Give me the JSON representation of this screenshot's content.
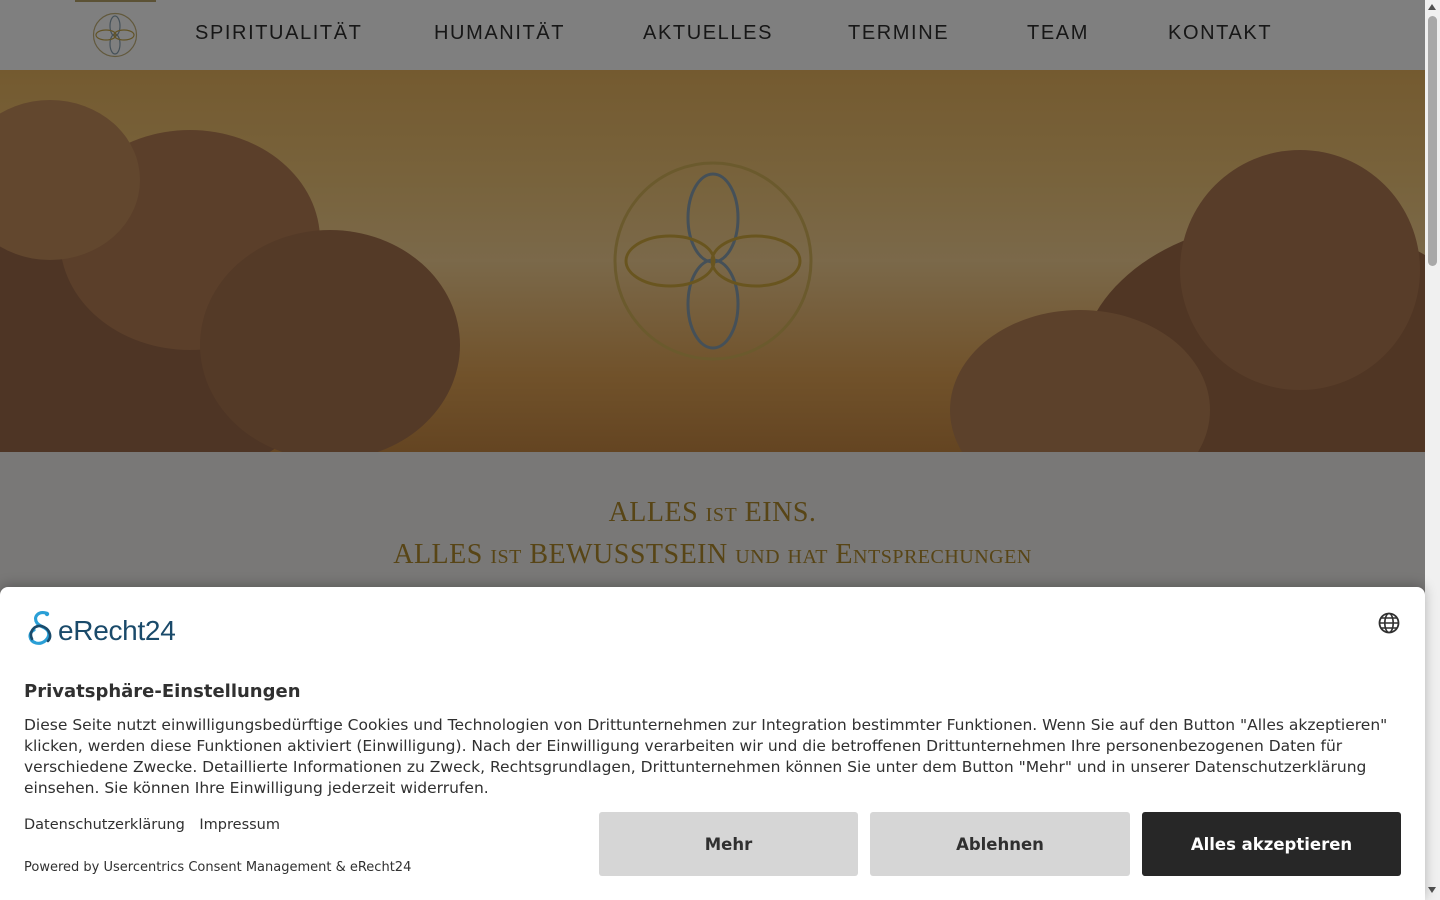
{
  "nav": {
    "items": [
      {
        "label": "SPIRITUALITÄT"
      },
      {
        "label": "HUMANITÄT"
      },
      {
        "label": "AKTUELLES"
      },
      {
        "label": "TERMINE"
      },
      {
        "label": "TEAM"
      },
      {
        "label": "KONTAKT"
      }
    ]
  },
  "hero": {
    "quote_lines": [
      "ALLES ist EINS.",
      "ALLES ist BEWUSSTSEIN und hat Entsprechungen"
    ]
  },
  "consent": {
    "brand": "eRecht24",
    "title": "Privatsphäre-Einstellungen",
    "description": "Diese Seite nutzt einwilligungsbedürftige Cookies und Technologien von Drittunternehmen zur Integration bestimmter Funktionen. Wenn Sie auf den Button \"Alles akzeptieren\" klicken, werden diese Funktionen aktiviert (Einwilligung). Nach der Einwilligung verarbeiten wir und die betroffenen Drittunternehmen Ihre personenbezogenen Daten für verschiedene Zwecke. Detaillierte Informationen zu Zweck, Rechtsgrundlagen, Drittunternehmen können Sie unter dem Button \"Mehr\" und in unserer Datenschutzerklärung einsehen. Sie können Ihre Einwilligung jederzeit widerrufen.",
    "links": {
      "privacy": "Datenschutzerklärung",
      "imprint": "Impressum"
    },
    "powered_by": "Powered by Usercentrics Consent Management & eRecht24",
    "buttons": {
      "more": "Mehr",
      "decline": "Ablehnen",
      "accept_all": "Alles akzeptieren"
    },
    "colors": {
      "accept_bg": "#272727",
      "secondary_bg": "#d6d6d6",
      "brand_blue": "#1a4a6a"
    }
  },
  "icons": {
    "site_logo": "four-petal-flower-icon",
    "language": "globe-icon"
  }
}
